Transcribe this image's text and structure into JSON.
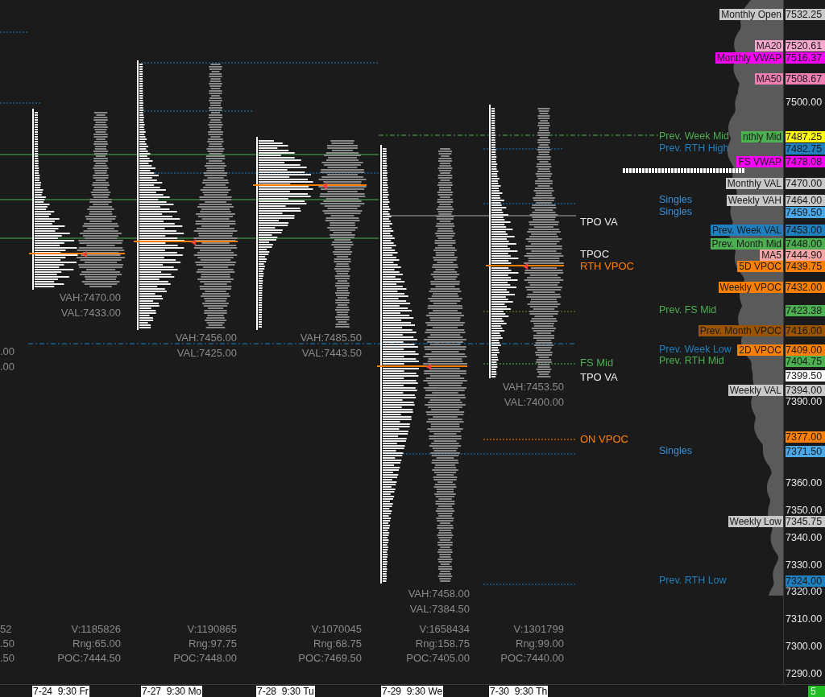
{
  "price_axis": {
    "ticks": [
      "7500.00",
      "7390.00",
      "7360.00",
      "7350.00",
      "7340.00",
      "7330.00",
      "7320.00",
      "7310.00",
      "7300.00",
      "7290.00"
    ]
  },
  "levels": [
    {
      "price": "7532.25",
      "color": "#c8c8c8",
      "tag": {
        "text": "Monthly Open",
        "color": "#c8c8c8"
      }
    },
    {
      "price": "7520.61",
      "color": "#f5a9cc",
      "tag": {
        "text": "MA20",
        "color": "#f5a9cc"
      }
    },
    {
      "price": "7516.37",
      "color": "#ff00ff",
      "tag": {
        "text": "Monthly VWAP",
        "color": "#ff00ff"
      }
    },
    {
      "price": "7508.67",
      "color": "#f07fb4",
      "tag": {
        "text": "MA50",
        "color": "#f07fb4"
      }
    },
    {
      "price": "7487.25",
      "color": "#ffff00",
      "tag": {
        "text": "nthly Mid",
        "color": "#4caf50"
      },
      "note": {
        "text": "Prev. Week Mid",
        "color": "#4caf50"
      }
    },
    {
      "price": "7482.75",
      "color": "#1f7fbf",
      "note": {
        "text": "Prev. RTH High",
        "color": "#1f7fbf"
      }
    },
    {
      "price": "7478.08",
      "color": "#ff00ff",
      "tag": {
        "text": "FS VWAP",
        "color": "#ff00ff"
      }
    },
    {
      "price": "7470.00",
      "color": "#c8c8c8",
      "tag": {
        "text": "Monthly VAL",
        "color": "#c8c8c8"
      }
    },
    {
      "price": "7464.00",
      "color": "#c8c8c8",
      "tag": {
        "text": "Weekly VAH",
        "color": "#c8c8c8"
      },
      "note": {
        "text": "Singles",
        "color": "#3a8fd8"
      }
    },
    {
      "price": "7459.50",
      "color": "#4aa8e8",
      "note": {
        "text": "Singles",
        "color": "#3a8fd8"
      }
    },
    {
      "price": "7453.00",
      "color": "#1f7fbf",
      "tag": {
        "text": "Prev. Week VAL",
        "color": "#1f7fbf"
      }
    },
    {
      "price": "7448.00",
      "color": "#4caf50",
      "tag": {
        "text": "Prev. Month Mid",
        "color": "#4caf50"
      }
    },
    {
      "price": "7444.90",
      "color": "#f4a6a6",
      "tag": {
        "text": "MA5",
        "color": "#f4a6a6"
      }
    },
    {
      "price": "7439.75",
      "color": "#ff8000",
      "tag": {
        "text": "5D VPOC",
        "color": "#ff8000"
      }
    },
    {
      "price": "7432.00",
      "color": "#ff8000",
      "tag": {
        "text": "Weekly VPOC",
        "color": "#ff8000"
      }
    },
    {
      "price": "7423.38",
      "color": "#4caf50",
      "note": {
        "text": "Prev. FS Mid",
        "color": "#4caf50"
      }
    },
    {
      "price": "7416.00",
      "color": "#9a5400",
      "tag": {
        "text": "Prev. Month VPOC",
        "color": "#9a5400"
      }
    },
    {
      "price": "7409.00",
      "color": "#ff8000",
      "tag": {
        "text": "2D VPOC",
        "color": "#ff8000"
      },
      "note": {
        "text": "Prev. Week Low",
        "color": "#1f7fbf"
      }
    },
    {
      "price": "7404.75",
      "color": "#4caf50",
      "note": {
        "text": "Prev. RTH Mid",
        "color": "#4caf50"
      }
    },
    {
      "price": "7399.50",
      "color": "#ffffff"
    },
    {
      "price": "7394.00",
      "color": "#c8c8c8",
      "tag": {
        "text": "Weekly VAL",
        "color": "#c8c8c8"
      }
    },
    {
      "price": "7377.00",
      "color": "#ff8000"
    },
    {
      "price": "7371.50",
      "color": "#4aa8e8",
      "note": {
        "text": "Singles",
        "color": "#3a8fd8"
      }
    },
    {
      "price": "7345.75",
      "color": "#c8c8c8",
      "tag": {
        "text": "Weekly Low",
        "color": "#c8c8c8"
      }
    },
    {
      "price": "7324.00",
      "color": "#1f7fbf",
      "note": {
        "text": "Prev. RTH Low",
        "color": "#1f7fbf"
      }
    }
  ],
  "annotations": [
    {
      "text": "TPO VA",
      "color": "#e8e8e8"
    },
    {
      "text": "TPOC",
      "color": "#e8e8e8"
    },
    {
      "text": "RTH VPOC",
      "color": "#ff8000"
    },
    {
      "text": "FS Mid",
      "color": "#4caf50"
    },
    {
      "text": "TPO VA",
      "color": "#e8e8e8"
    },
    {
      "text": "ON VPOC",
      "color": "#ff8000"
    }
  ],
  "previous_session_partial": {
    "value_area": [
      ".00",
      ".00"
    ],
    "stats": [
      "52",
      ".50",
      ".50"
    ]
  },
  "sessions": [
    {
      "time": "7-24  9:30 Fr",
      "vah": "VAH:7470.00",
      "val": "VAL:7433.00",
      "volume": "V:1185826",
      "range": "Rng:65.00",
      "poc": "POC:7444.50"
    },
    {
      "time": "7-27  9:30 Mo",
      "vah": "VAH:7456.00",
      "val": "VAL:7425.00",
      "volume": "V:1190865",
      "range": "Rng:97.75",
      "poc": "POC:7448.00"
    },
    {
      "time": "7-28  9:30 Tu",
      "vah": "VAH:7485.50",
      "val": "VAL:7443.50",
      "volume": "V:1070045",
      "range": "Rng:68.75",
      "poc": "POC:7469.50"
    },
    {
      "time": "7-29  9:30 We",
      "vah": "VAH:7458.00",
      "val": "VAL:7384.50",
      "volume": "V:1658434",
      "range": "Rng:158.75",
      "poc": "POC:7405.00"
    },
    {
      "time": "7-30  9:30 Th",
      "vah": "VAH:7453.50",
      "val": "VAL:7400.00",
      "volume": "V:1301799",
      "range": "Rng:99.00",
      "poc": "POC:7440.00"
    }
  ],
  "corner_badge": "5"
}
